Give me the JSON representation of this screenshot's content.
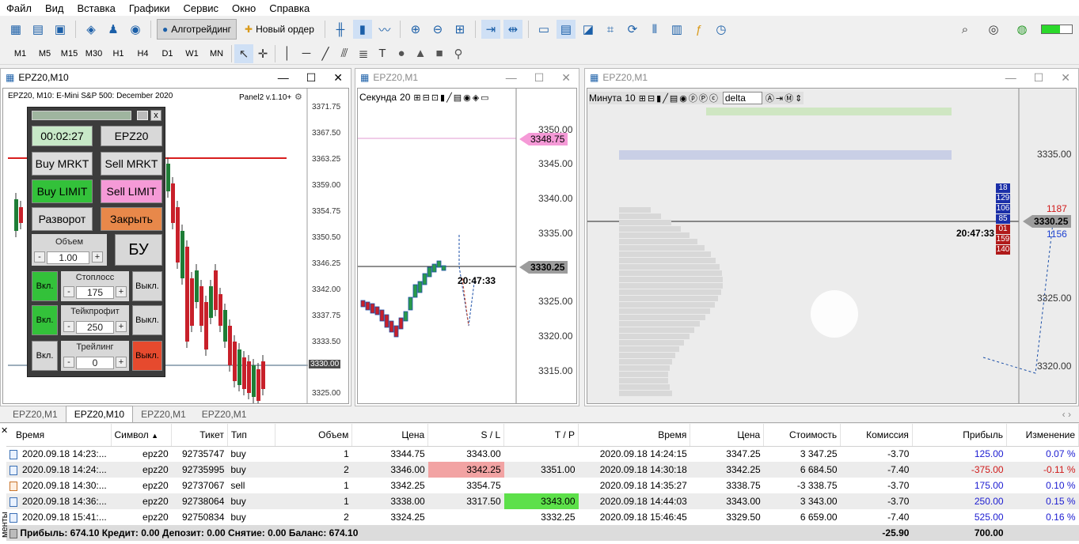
{
  "menu": [
    "Файл",
    "Вид",
    "Вставка",
    "Графики",
    "Сервис",
    "Окно",
    "Справка"
  ],
  "toolbar": {
    "algo_label": "Алготрейдинг",
    "new_order_label": "Новый ордер"
  },
  "timeframes": [
    "M1",
    "M5",
    "M15",
    "M30",
    "H1",
    "H4",
    "D1",
    "W1",
    "MN"
  ],
  "win1": {
    "title": "EPZ20,M10",
    "header": "EPZ20, M10:  E-Mini S&P 500: December 2020",
    "panel_label": "Panel2 v.1.10+",
    "price_labels": [
      "3371.75",
      "3367.50",
      "3363.25",
      "3359.00",
      "3354.75",
      "3350.50",
      "3346.25",
      "3342.00",
      "3337.75",
      "3333.50",
      "3330.00",
      "3325.00"
    ],
    "current_price": "3330.00"
  },
  "panel": {
    "timer": "00:02:27",
    "symbol": "EPZ20",
    "buy_mrkt": "Buy MRKT",
    "sell_mrkt": "Sell MRKT",
    "buy_limit": "Buy LIMIT",
    "sell_limit": "Sell LIMIT",
    "reverse": "Разворот",
    "close": "Закрыть",
    "volume_label": "Объем",
    "volume_value": "1.00",
    "bu": "БУ",
    "stop_label": "Стоплосс",
    "stop_value": "175",
    "take_label": "Тейкпрофит",
    "take_value": "250",
    "trail_label": "Трейлинг",
    "trail_value": "0",
    "on": "Вкл.",
    "off": "Выкл.",
    "minus": "-",
    "plus": "+",
    "close_x": "x"
  },
  "win2": {
    "title": "EPZ20,M1",
    "mode": "Секунда",
    "mode_value": "20",
    "price_labels": [
      "3350.00",
      "3345.00",
      "3340.00",
      "3335.00",
      "3325.00",
      "3320.00",
      "3315.00"
    ],
    "marker_price": "3348.75",
    "current_price": "3330.25",
    "time_label": "20:47:33"
  },
  "win3": {
    "title": "EPZ20,M1",
    "mode": "Минута",
    "mode_value": "10",
    "filter": "delta",
    "price_labels": [
      "3335.00",
      "3325.00",
      "3320.00"
    ],
    "current_price": "3330.25",
    "time_label": "20:47:33",
    "right_counts": [
      "18",
      "129",
      "106",
      "85",
      "01",
      "159",
      "140"
    ],
    "side_values": [
      "1187",
      "1156"
    ]
  },
  "tabs": [
    "EPZ20,M1",
    "EPZ20,M10",
    "EPZ20,M1",
    "EPZ20,M1"
  ],
  "table": {
    "headers": [
      "Время",
      "Символ",
      "Тикет",
      "Тип",
      "Объем",
      "Цена",
      "S / L",
      "T / P",
      "Время",
      "Цена",
      "Стоимость",
      "Комиссия",
      "Прибыль",
      "Изменение"
    ],
    "rows": [
      [
        "2020.09.18 14:23:...",
        "epz20",
        "92735747",
        "buy",
        "1",
        "3344.75",
        "3343.00",
        "",
        "2020.09.18 14:24:15",
        "3347.25",
        "3 347.25",
        "-3.70",
        "125.00",
        "0.07 %"
      ],
      [
        "2020.09.18 14:24:...",
        "epz20",
        "92735995",
        "buy",
        "2",
        "3346.00",
        "3342.25",
        "3351.00",
        "2020.09.18 14:30:18",
        "3342.25",
        "6 684.50",
        "-7.40",
        "-375.00",
        "-0.11 %"
      ],
      [
        "2020.09.18 14:30:...",
        "epz20",
        "92737067",
        "sell",
        "1",
        "3342.25",
        "3354.75",
        "",
        "2020.09.18 14:35:27",
        "3338.75",
        "-3 338.75",
        "-3.70",
        "175.00",
        "0.10 %"
      ],
      [
        "2020.09.18 14:36:...",
        "epz20",
        "92738064",
        "buy",
        "1",
        "3338.00",
        "3317.50",
        "3343.00",
        "2020.09.18 14:44:03",
        "3343.00",
        "3 343.00",
        "-3.70",
        "250.00",
        "0.15 %"
      ],
      [
        "2020.09.18 15:41:...",
        "epz20",
        "92750834",
        "buy",
        "2",
        "3324.25",
        "",
        "3332.25",
        "2020.09.18 15:46:45",
        "3329.50",
        "6 659.00",
        "-7.40",
        "525.00",
        "0.16 %"
      ]
    ],
    "total": {
      "summary": "Прибыль: 674.10  Кредит: 0.00  Депозит: 0.00  Снятие: 0.00  Баланс: 674.10",
      "commission": "-25.90",
      "profit": "700.00"
    },
    "side_label": "менты"
  },
  "colors": {
    "buy_green": "#33c13a",
    "sell_pink": "#f59ad7",
    "orange": "#e8884a",
    "red_off": "#e64a2e",
    "loss_cell": "#f2a3a3",
    "tp_cell": "#5de04a",
    "bull": "#1e7d36",
    "bear": "#c8202a"
  }
}
